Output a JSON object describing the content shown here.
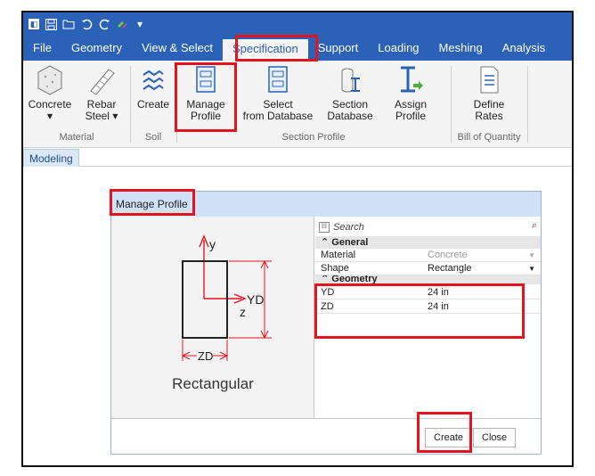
{
  "menu_tabs": [
    "File",
    "Geometry",
    "View & Select",
    "Specification",
    "Support",
    "Loading",
    "Meshing",
    "Analysis"
  ],
  "ribbon": {
    "concrete_label": "Concrete",
    "rebar_label_1": "Rebar",
    "rebar_label_2": "Steel",
    "create_label": "Create",
    "manage_label_1": "Manage",
    "manage_label_2": "Profile",
    "select_label_1": "Select",
    "select_label_2": "from Database",
    "section_label_1": "Section",
    "section_label_2": "Database",
    "assign_label_1": "Assign",
    "assign_label_2": "Profile",
    "rates_label_1": "Define",
    "rates_label_2": "Rates",
    "group_material": "Material",
    "group_soil": "Soil",
    "group_section_profile": "Section Profile",
    "group_boq": "Bill of Quantity"
  },
  "doc_tab": "Modeling",
  "dialog": {
    "title": "Manage Profile",
    "diagram": {
      "y_axis": "y",
      "z_axis": "z",
      "yd_label": "YD",
      "zd_label": "ZD"
    },
    "caption": "Rectangular",
    "search_placeholder": "Search",
    "general_header": "General",
    "geometry_header": "Geometry",
    "props": [
      {
        "key": "Material",
        "value": "Concrete"
      },
      {
        "key": "Shape",
        "value": "Rectangle"
      },
      {
        "key": "YD",
        "value": "24 in"
      },
      {
        "key": "ZD",
        "value": "24 in"
      }
    ],
    "create_button": "Create",
    "close_button": "Close"
  },
  "colors": {
    "accent": "#2b62b7",
    "highlight": "#e2141e",
    "dialog_title_bg": "#cfe2f8"
  }
}
